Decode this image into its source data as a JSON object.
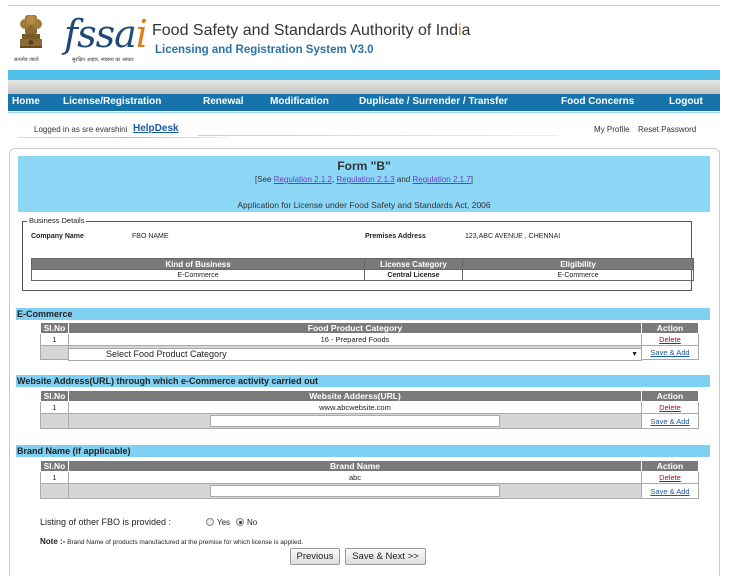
{
  "header": {
    "emblem_motto": "सत्यमेव जयते",
    "logo_text": "fssai",
    "logo_tagline": "सुरक्षित आहार, स्वास्थ्य का आधार",
    "org_title_a": "Food Safety and Standards Authority of Ind",
    "org_title_b": "i",
    "org_title_c": "a",
    "system_title": "Licensing and Registration System V3.0"
  },
  "nav": {
    "home": "Home",
    "license": "License/Registration",
    "renewal": "Renewal",
    "modification": "Modification",
    "duplicate": "Duplicate / Surrender / Transfer",
    "concerns": "Food Concerns",
    "logout": "Logout"
  },
  "userbar": {
    "logged_in": "Logged in as sre evarshini",
    "helpdesk": "HelpDesk",
    "my_profile": "My Profile",
    "reset_password": "Reset Password"
  },
  "form": {
    "title": "Form \"B\"",
    "see_prefix": "[See ",
    "reg1": "Regulation 2.1.2",
    "sep1": ", ",
    "reg2": "Regulation 2.1.3",
    "and": " and ",
    "reg3": "Regulation 2.1.7",
    "see_suffix": "]",
    "application": "Application for License under Food Safety and Standards Act, 2006"
  },
  "business": {
    "legend": "Business Details",
    "company_label": "Company Name",
    "company_value": "FBO NAME",
    "premises_label": "Premises Address",
    "premises_value": "123,ABC AVENUE , CHENNAI",
    "headers": [
      "Kind of Business",
      "License Category",
      "Eligibility"
    ],
    "row": [
      "E-Commerce",
      "Central License",
      "E-Commerce"
    ]
  },
  "ecommerce": {
    "section_title": "E-Commerce",
    "col_slno": "Sl.No",
    "col_category": "Food Product Category",
    "col_action": "Action",
    "row_no": "1",
    "row_value": "16 - Prepared Foods",
    "delete": "Delete",
    "save_add": "Save & Add",
    "select_placeholder": "Select Food Product Category"
  },
  "website": {
    "section_title": "Website Address(URL) through which e-Commerce activity carried out",
    "col_slno": "Sl.No",
    "col_url": "Website Adderss(URL)",
    "col_action": "Action",
    "row_no": "1",
    "row_value": "www.abcwebsite.com",
    "delete": "Delete",
    "save_add": "Save & Add"
  },
  "brand": {
    "section_title": "Brand Name (if applicable)",
    "col_slno": "Sl.No",
    "col_brand": "Brand Name",
    "col_action": "Action",
    "row_no": "1",
    "row_value": "abc",
    "delete": "Delete",
    "save_add": "Save & Add"
  },
  "listing": {
    "label": "Listing of other FBO is provided :",
    "yes": "Yes",
    "no": "No",
    "selected": "No"
  },
  "note": {
    "prefix": "Note :-",
    "text": " Brand Name of products manufactured at the premise for which license is applied."
  },
  "buttons": {
    "previous": "Previous",
    "save_next": "Save & Next >>"
  },
  "colors": {
    "nav": "#1773ab",
    "section": "#7fd0f2",
    "form_head": "#8cd7f5",
    "table_header": "#7a7a7a"
  }
}
